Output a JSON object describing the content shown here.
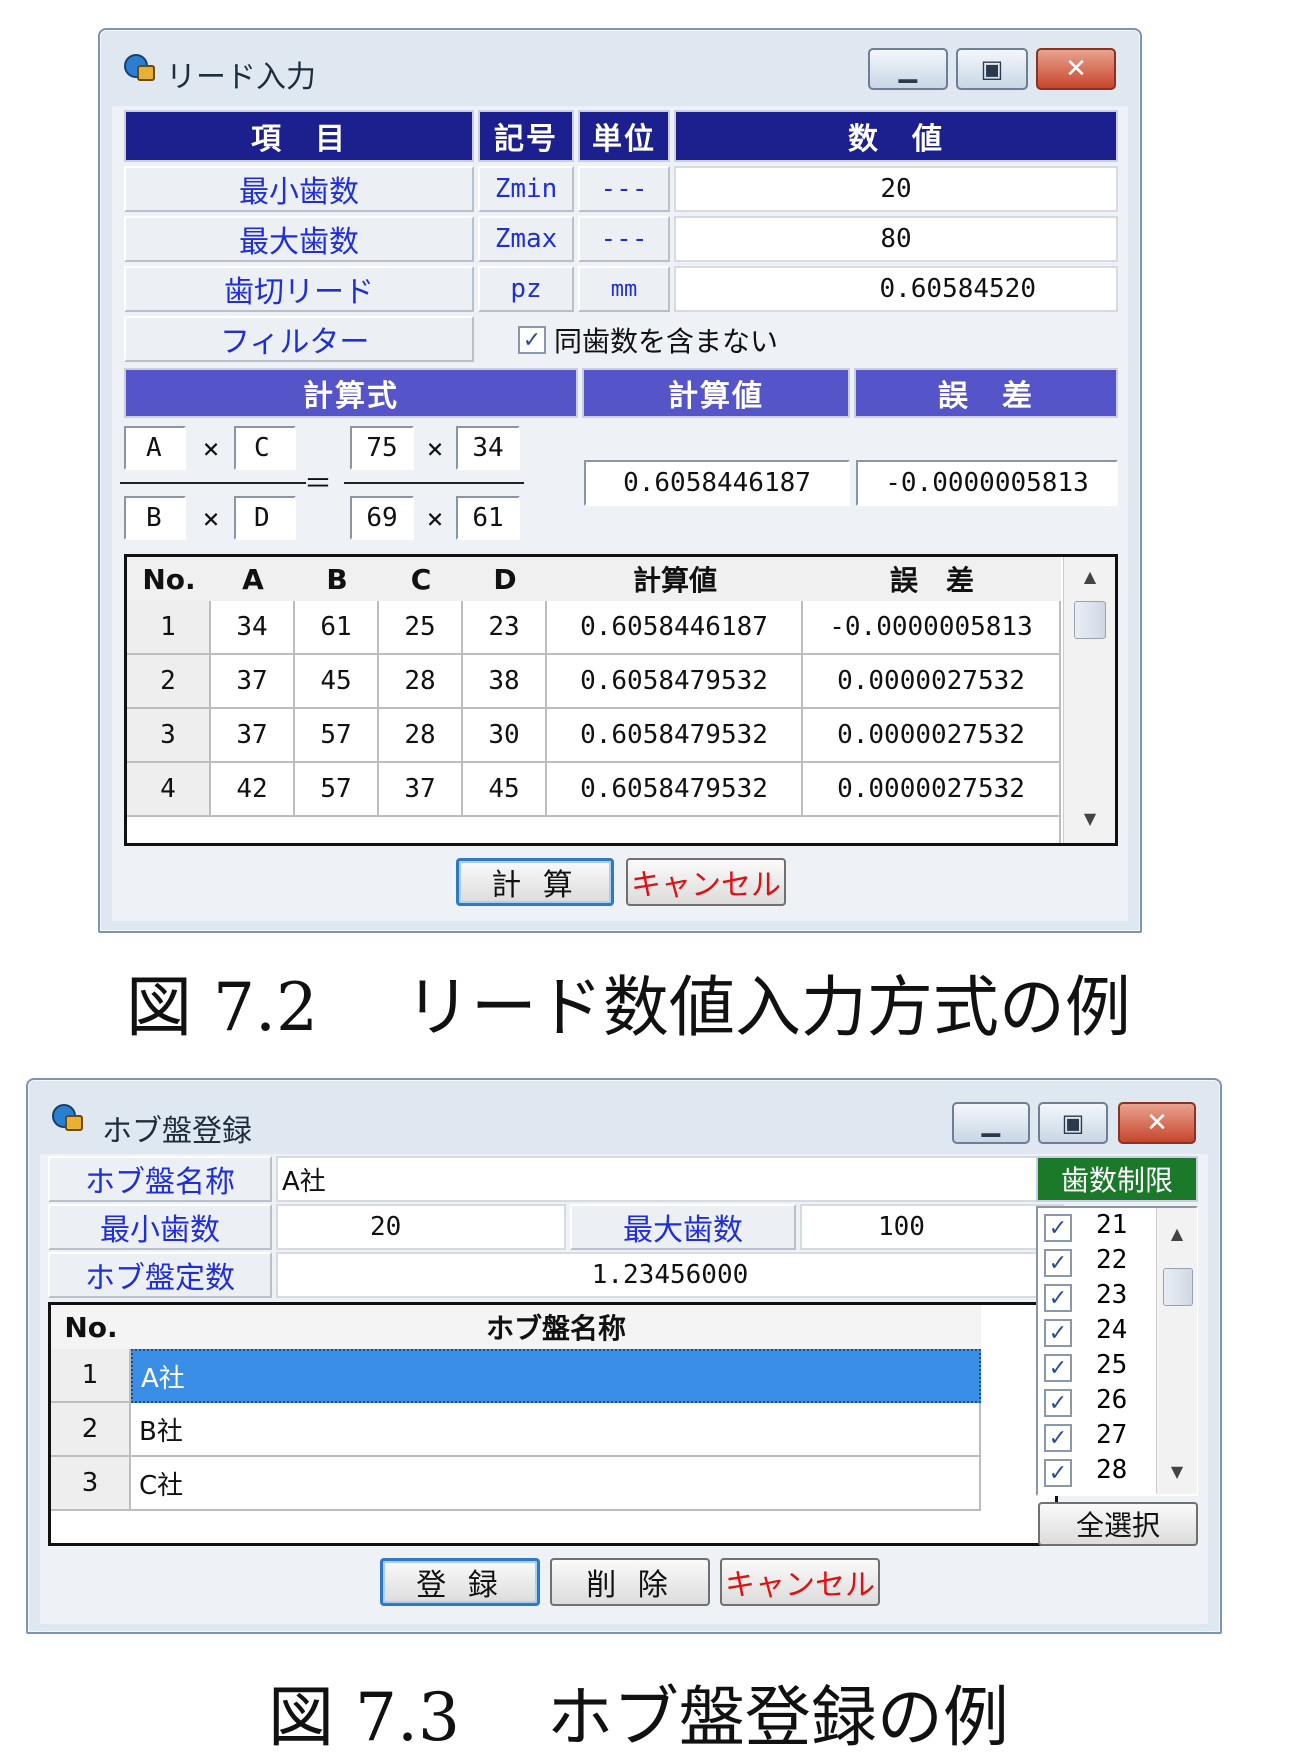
{
  "lead_window": {
    "title": "リード入力",
    "headers": {
      "item": "項　目",
      "symbol": "記号",
      "unit": "単位",
      "value": "数　値"
    },
    "rows": [
      {
        "label": "最小歯数",
        "symbol": "Zmin",
        "unit": "---",
        "value": "20"
      },
      {
        "label": "最大歯数",
        "symbol": "Zmax",
        "unit": "---",
        "value": "80"
      },
      {
        "label": "歯切リード",
        "symbol": "pz",
        "unit": "mm",
        "value": "0.60584520"
      }
    ],
    "filter": {
      "label": "フィルター",
      "checkbox_label": "同歯数を含まない",
      "checked": true
    },
    "calc_headers": {
      "formula": "計算式",
      "calc_value": "計算値",
      "error": "誤　差"
    },
    "formula": {
      "a": "A",
      "b": "B",
      "c": "C",
      "d": "D",
      "times": "×",
      "equals": "＝",
      "a_val": "75",
      "c_val": "34",
      "b_val": "69",
      "d_val": "61"
    },
    "calc_value": "0.6058446187",
    "error_value": "-0.0000005813",
    "grid": {
      "columns": [
        "No.",
        "A",
        "B",
        "C",
        "D",
        "計算値",
        "誤　差"
      ],
      "rows": [
        [
          "1",
          "34",
          "61",
          "25",
          "23",
          "0.6058446187",
          "-0.0000005813"
        ],
        [
          "2",
          "37",
          "45",
          "28",
          "38",
          "0.6058479532",
          "0.0000027532"
        ],
        [
          "3",
          "37",
          "57",
          "28",
          "30",
          "0.6058479532",
          "0.0000027532"
        ],
        [
          "4",
          "42",
          "57",
          "37",
          "45",
          "0.6058479532",
          "0.0000027532"
        ]
      ]
    },
    "buttons": {
      "calc": "計 算",
      "cancel": "キャンセル"
    }
  },
  "caption_1": "図 7.2　 リード数値入力方式の例",
  "hob_window": {
    "title": "ホブ盤登録",
    "fields": {
      "name_label": "ホブ盤名称",
      "name_value": "A社",
      "min_label": "最小歯数",
      "min_value": "20",
      "max_label": "最大歯数",
      "max_value": "100",
      "const_label": "ホブ盤定数",
      "const_value": "1.23456000"
    },
    "grid": {
      "columns": [
        "No.",
        "ホブ盤名称"
      ],
      "rows": [
        [
          "1",
          "A社"
        ],
        [
          "2",
          "B社"
        ],
        [
          "3",
          "C社"
        ]
      ],
      "selected_row": 0
    },
    "teeth_limit": {
      "header": "歯数制限",
      "items": [
        "21",
        "22",
        "23",
        "24",
        "25",
        "26",
        "27",
        "28"
      ],
      "select_all": "全選択"
    },
    "buttons": {
      "register": "登 録",
      "delete": "削 除",
      "cancel": "キャンセル"
    }
  },
  "caption_2": "図 7.3　 ホブ盤登録の例",
  "colors": {
    "header_dark": "#1c1f8e",
    "header_mid": "#5554c8",
    "label_blue": "#1f2fd8",
    "green_header": "#1b7a2a",
    "selection": "#3a8ee6",
    "cancel_red": "#e01010"
  }
}
